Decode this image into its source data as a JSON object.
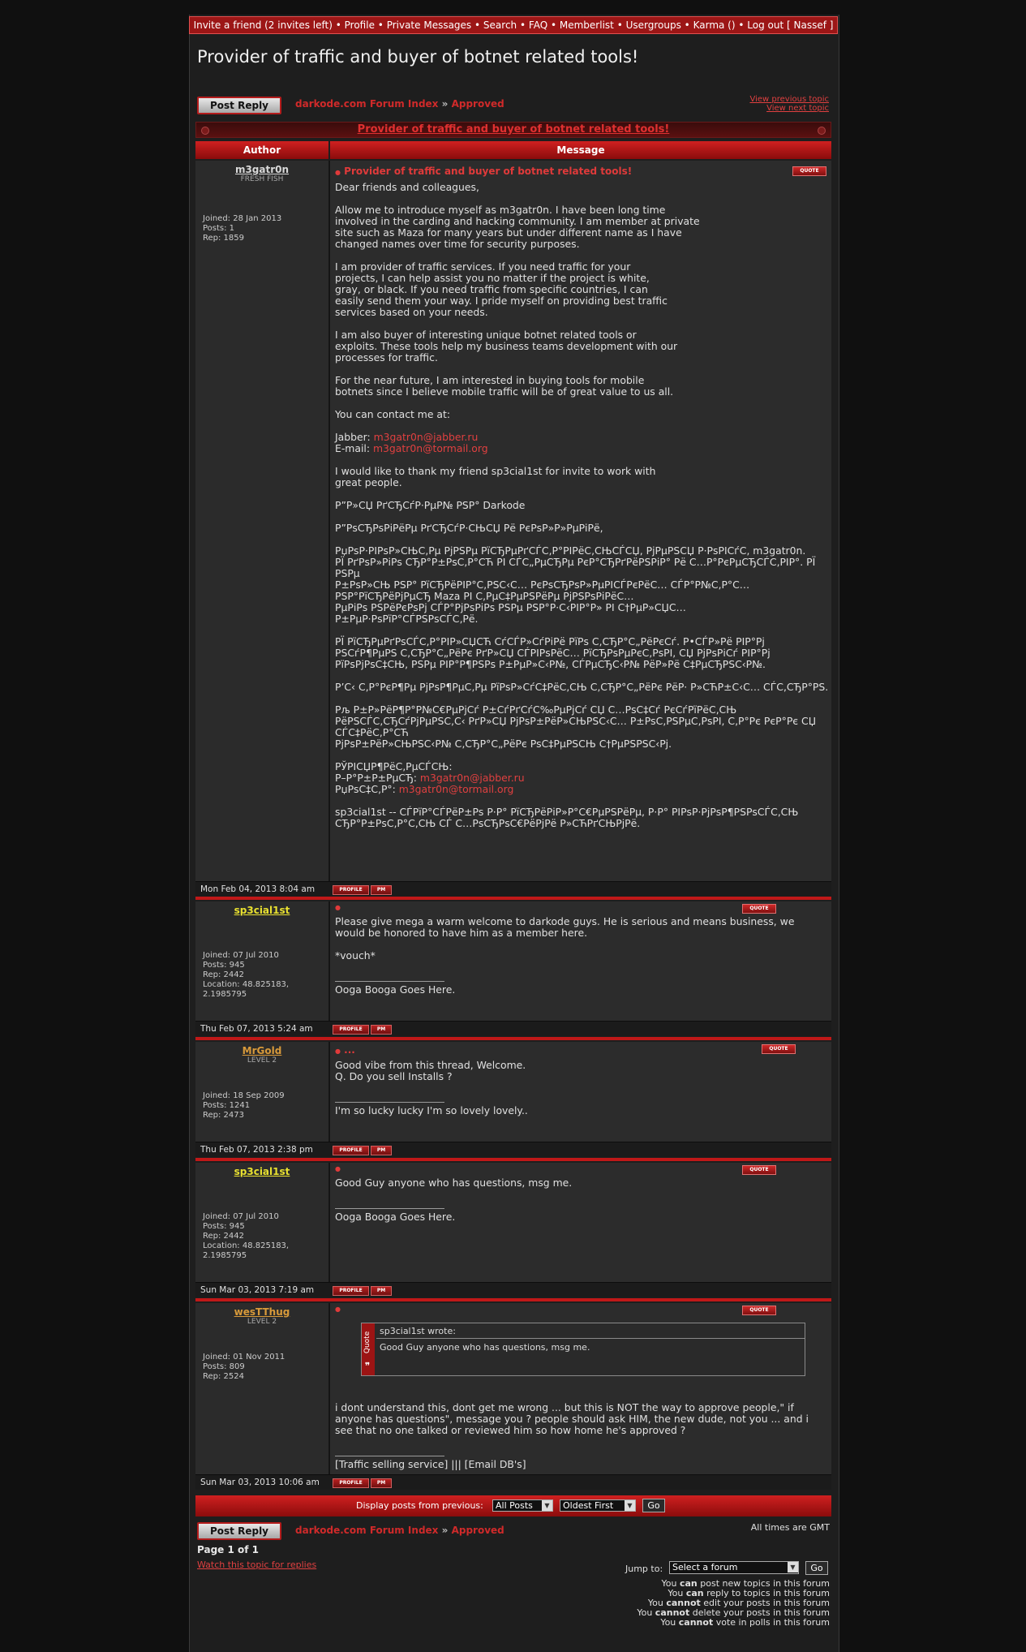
{
  "topnav": {
    "items": [
      "Invite a friend (2 invites left)",
      "Profile",
      "Private Messages",
      "Search",
      "FAQ",
      "Memberlist",
      "Usergroups",
      "Karma ()",
      "Log out [ Nassef ]"
    ],
    "separator": "•"
  },
  "page_title": "Provider of traffic and buyer of botnet related tools!",
  "post_reply_label": "Post Reply",
  "breadcrumb": {
    "forum_index": "darkode.com Forum Index",
    "arrow": "»",
    "category": "Approved"
  },
  "view_links": {
    "previous": "View previous topic",
    "next": "View next topic"
  },
  "topic_title": "Provider of traffic and buyer of botnet related tools!",
  "table_headers": {
    "author": "Author",
    "message": "Message"
  },
  "quote_label": "QUOTE",
  "profile_label": "PROFILE",
  "pm_label": "PM",
  "posts": [
    {
      "username": "m3gatr0n",
      "username_color": "#d8d8d8",
      "rank": "FRESH FISH",
      "stats": "Joined: 28 Jan 2013\nPosts: 1\nRep: 1859",
      "subject": "Provider of traffic and buyer of botnet related tools!",
      "body_before": "Dear friends and colleagues,\n\nAllow me to introduce myself as m3gatr0n. I have been long time\ninvolved in the carding and hacking community. I am member at private\nsite such as Maza for many years but under different name as I have\nchanged names over time for security purposes.\n\nI am provider of traffic services. If you need traffic for your\nprojects, I can help assist you no matter if the project is white,\ngray, or black. If you need traffic from specific countries, I can\neasily send them your way. I pride myself on providing best traffic\nservices based on your needs.\n\nI am also buyer of interesting unique botnet related tools or\nexploits. These tools help my business teams development with our\nprocesses for traffic.\n\nFor the near future, I am interested in buying tools for mobile\nbotnets since I believe mobile traffic will be of great value to us all.\n\nYou can contact me at:\n",
      "jabber_label": "Jabber: ",
      "jabber": "m3gatr0n@jabber.ru",
      "email_label": "E-mail: ",
      "email": "m3gatr0n@tormail.org",
      "body_middle": "I would like to thank my friend sp3cial1st for invite to work with\ngreat people.\n\nР”Р»СЏ РґСЂСѓР·РµР№ РЅР° Darkode\n\nР”РѕСЂРѕРіРёРµ РґСЂСѓР·СЊСЏ Рё РєРѕР»Р»РµРіРё,\n\nРџРѕР·РІРѕР»СЊС‚Рµ РјРЅРµ РїСЂРµРґСЃС‚Р°РІРёС‚СЊСЃСЏ, РјРµРЅСЏ Р·РѕРІСѓС‚ m3gatr0n.\nРЇ РґРѕР»РіРѕ СЂР°Р±РѕС‚Р°СЋ РІ СЃС„РµСЂРµ РєР°СЂРґРёРЅРіР° Рё С…Р°РєРµСЂСЃС‚РІР°. РЇ РЅРµ\nР±РѕР»СЊ РЅР° РїСЂРёРІР°С‚РЅС‹С… РєРѕСЂРѕР»РµРІСЃРєРёС… СЃР°Р№С‚Р°С… РЅР°РїСЂРёРјРµСЂ Maza РІ С‚РµС‡РµРЅРёРµ РјРЅРѕРіРёС…\nРµРіРѕ РЅРёРєРѕРј СЃР°РјРѕРіРѕ РЅРµ РЅР°Р·С‹РІР°Р» РІ С†РµР»СЏС… Р±РµР·РѕРїР°СЃРЅРѕСЃС‚Рё.\n\nРЇ РїСЂРµРґРѕСЃС‚Р°РІР»СЏСЋ СѓСЃР»СѓРіРё РїРѕ С‚СЂР°С„РёРєСѓ. Р•СЃР»Рё РІР°Рј\nРЅСѓР¶РµРЅ С‚СЂР°С„РёРє РґР»СЏ СЃРІРѕРёС… РїСЂРѕРµРєС‚РѕРІ, СЏ РјРѕРіСѓ РІР°Рј\nРїРѕРјРѕС‡СЊ, РЅРµ РІР°Р¶РЅРѕ Р±РµР»С‹Р№, СЃРµСЂС‹Р№ РёР»Рё С‡РµСЂРЅС‹Р№.\n\nР’С‹ С‚Р°РєР¶Рµ РјРѕР¶РµС‚Рµ РїРѕР»СѓС‡РёС‚СЊ С‚СЂР°С„РёРє РёР· Р»СЋР±С‹С… СЃС‚СЂР°РЅ.",
      "body_middle_2": "Рљ Р±Р»РёР¶Р°Р№С€РµРјСѓ Р±СѓРґСѓС‰РµРјСѓ СЏ С…РѕС‡Сѓ РєСѓРїРёС‚СЊ\nРёРЅСЃС‚СЂСѓРјРµРЅС‚С‹ РґР»СЏ РјРѕР±РёР»СЊРЅС‹С… Р±РѕС‚РЅРµС‚РѕРІ, С‚Р°Рє РєР°Рє СЏ СЃС‡РёС‚Р°СЋ\nРјРѕР±РёР»СЊРЅС‹Р№ С‚СЂР°С„РёРє РѕС‡РµРЅСЊ С†РµРЅРЅС‹Рј.\n\nРЎРІСЏР¶РёС‚РµСЃСЊ:",
      "jabber_label_2": "Р–Р°Р±Р±РµСЂ: ",
      "email_label_2": "РџРѕС‡С‚Р°: ",
      "body_after": "sp3cial1st -- СЃРїР°СЃРёР±Рѕ Р·Р° РїСЂРёРіР»Р°С€РµРЅРёРµ, Р·Р° РІРѕР·РјРѕР¶РЅРѕСЃС‚СЊ\nСЂР°Р±РѕС‚Р°С‚СЊ СЃ С…РѕСЂРѕС€РёРјРё Р»СЋРґСЊРјРё.",
      "date": "Mon Feb 04, 2013 8:04 am"
    },
    {
      "username": "sp3cial1st",
      "username_color": "#e8e030",
      "rank": "",
      "stats": "Joined: 07 Jul 2010\nPosts: 945\nRep: 2442\nLocation: 48.825183,\n2.1985795",
      "body": "Please give mega a warm welcome to darkode guys. He is serious and means business, we\nwould be honored to have him as a member here.\n\n*vouch*",
      "signature": "Ooga Booga Goes Here.",
      "date": "Thu Feb 07, 2013 5:24 am"
    },
    {
      "username": "MrGold",
      "username_color": "#d89a3a",
      "rank": "LEVEL 2",
      "stats": "Joined: 18 Sep 2009\nPosts: 1241\nRep: 2473",
      "subject": "...",
      "body": "Good vibe from this thread, Welcome.\nQ. Do you sell Installs ?",
      "signature": "I'm so lucky lucky I'm so lovely lovely..",
      "date": "Thu Feb 07, 2013 2:38 pm"
    },
    {
      "username": "sp3cial1st",
      "username_color": "#e8e030",
      "rank": "",
      "stats": "Joined: 07 Jul 2010\nPosts: 945\nRep: 2442\nLocation: 48.825183,\n2.1985795",
      "body": "Good Guy anyone who has questions, msg me.",
      "signature": "Ooga Booga Goes Here.",
      "date": "Sun Mar 03, 2013 7:19 am"
    },
    {
      "username": "wesTThug",
      "username_color": "#d89a3a",
      "rank": "LEVEL 2",
      "stats": "Joined: 01 Nov 2011\nPosts: 809\nRep: 2524",
      "quote_tag": "Quote",
      "quote_author": "sp3cial1st wrote:",
      "quote_text": "Good Guy anyone who has questions, msg me.",
      "body": "i dont understand this, dont get me wrong ... but this is NOT the way to approve people,\" if\nanyone has questions\", message you ? people should ask HIM, the new dude, not you ... and i\nsee that no one talked or reviewed him so how home he's approved ?",
      "signature": "[Traffic selling service] ||| [Email DB's]",
      "date": "Sun Mar 03, 2013 10:06 am"
    }
  ],
  "display_bar": {
    "label": "Display posts from previous:",
    "posts_option": "All Posts",
    "order_option": "Oldest First",
    "go": "Go"
  },
  "timezone": "All times are GMT",
  "pagination": "Page 1 of 1",
  "watch_link": "Watch this topic for replies",
  "jump": {
    "label": "Jump to:",
    "placeholder": "Select a forum",
    "go": "Go"
  },
  "permissions": [
    {
      "pre": "You ",
      "bold": "can",
      "post": " post new topics in this forum"
    },
    {
      "pre": "You ",
      "bold": "can",
      "post": " reply to topics in this forum"
    },
    {
      "pre": "You ",
      "bold": "cannot",
      "post": " edit your posts in this forum"
    },
    {
      "pre": "You ",
      "bold": "cannot",
      "post": " delete your posts in this forum"
    },
    {
      "pre": "You ",
      "bold": "cannot",
      "post": " vote in polls in this forum"
    }
  ]
}
